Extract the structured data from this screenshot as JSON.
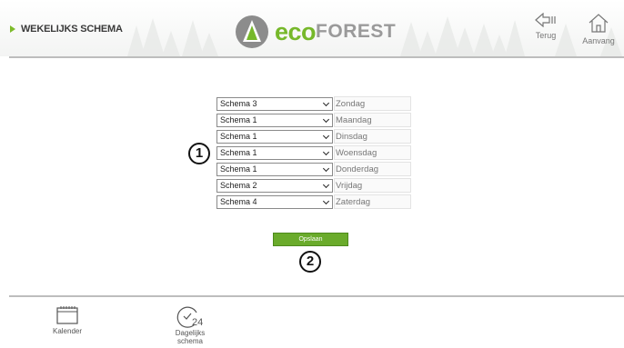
{
  "header": {
    "title": "WEKELIJKS SCHEMA",
    "brand_eco": "eco",
    "brand_forest": "FOREST",
    "back_label": "Terug",
    "home_label": "Aanvang"
  },
  "schedule": {
    "rows": [
      {
        "schema": "Schema 3",
        "day": "Zondag"
      },
      {
        "schema": "Schema 1",
        "day": "Maandag"
      },
      {
        "schema": "Schema 1",
        "day": "Dinsdag"
      },
      {
        "schema": "Schema 1",
        "day": "Woensdag"
      },
      {
        "schema": "Schema 1",
        "day": "Donderdag"
      },
      {
        "schema": "Schema 2",
        "day": "Vrijdag"
      },
      {
        "schema": "Schema 4",
        "day": "Zaterdag"
      }
    ]
  },
  "annotations": {
    "one": "1",
    "two": "2"
  },
  "save_label": "Opslaan",
  "footer": {
    "calendar_label": "Kalender",
    "daily_label_1": "Dagelijks",
    "daily_label_2": "schema",
    "daily_icon_text": "24"
  },
  "colors": {
    "accent": "#76b82a",
    "button": "#6aab2b",
    "brand_gray": "#9a9a9a"
  },
  "icons": [
    "logo-leaf-icon",
    "back-arrow-icon",
    "home-icon",
    "calendar-icon",
    "clock-24-icon",
    "chevron-down-icon"
  ]
}
